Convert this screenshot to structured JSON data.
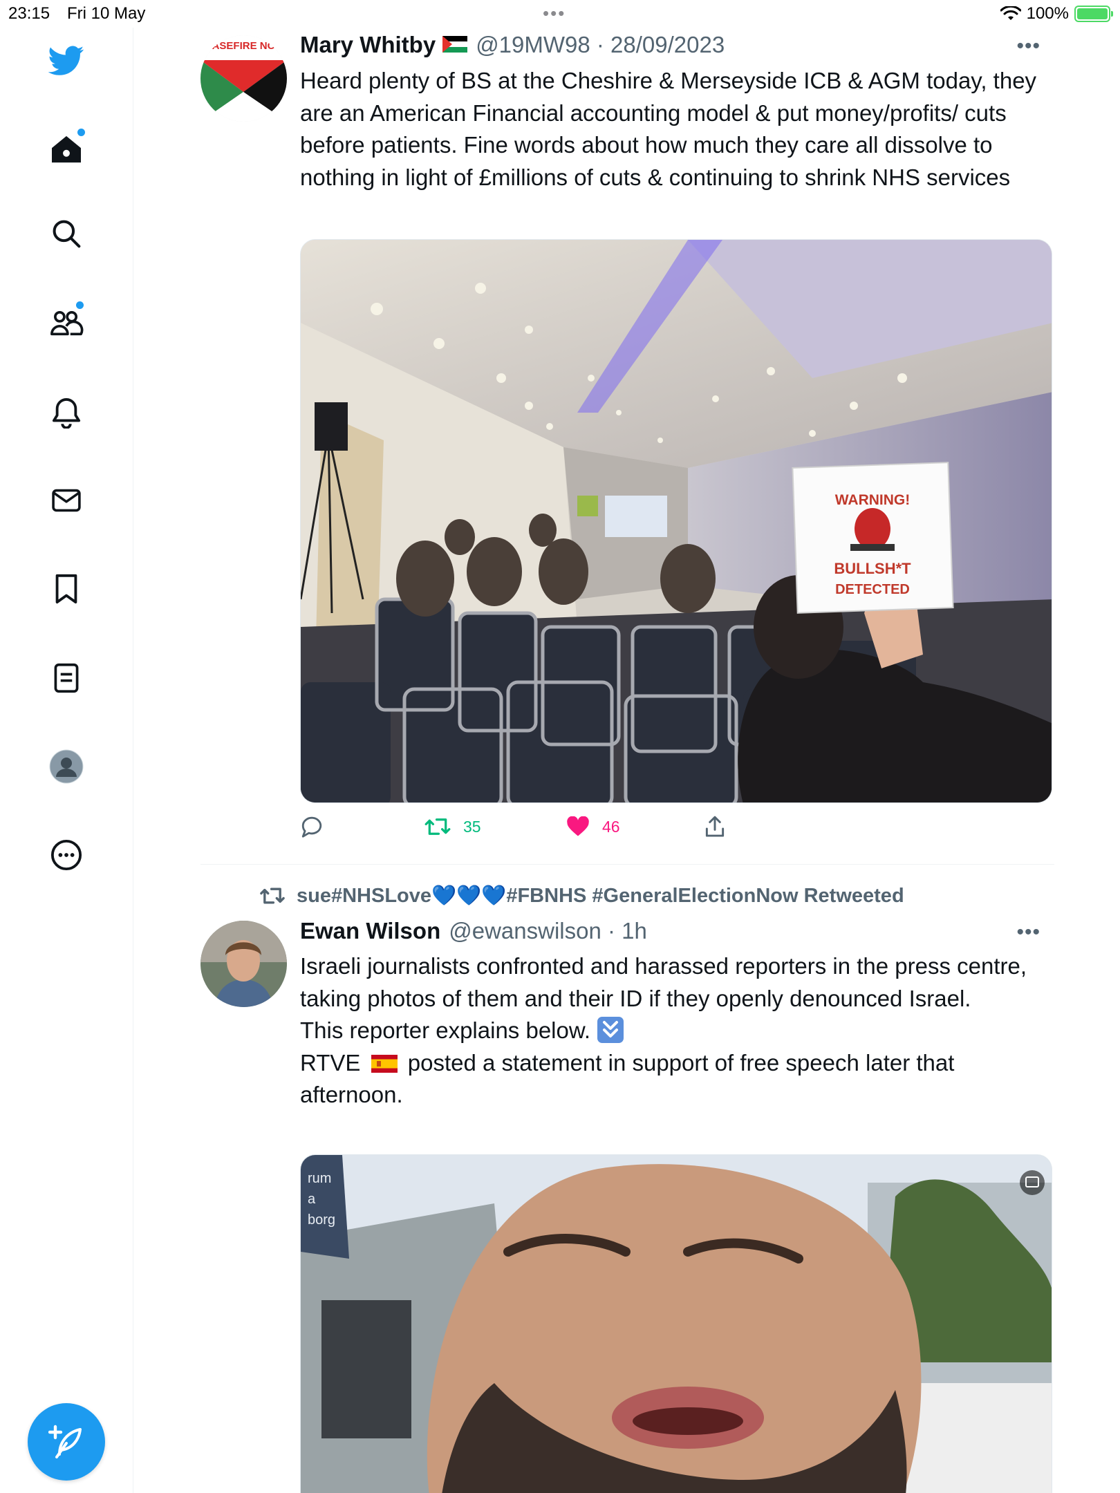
{
  "status_bar": {
    "time": "23:15",
    "date": "Fri 10 May",
    "battery": "100%",
    "battery_level": 1.0
  },
  "sidebar": {
    "items": [
      {
        "name": "home",
        "icon": "home-icon",
        "has_notification_dot": true
      },
      {
        "name": "explore",
        "icon": "search-icon"
      },
      {
        "name": "communities",
        "icon": "communities-icon",
        "has_notification_dot": true
      },
      {
        "name": "notifications",
        "icon": "bell-icon"
      },
      {
        "name": "messages",
        "icon": "mail-icon"
      },
      {
        "name": "bookmarks",
        "icon": "bookmark-icon"
      },
      {
        "name": "lists",
        "icon": "list-icon"
      },
      {
        "name": "profile",
        "icon": "profile-avatar-icon"
      },
      {
        "name": "more",
        "icon": "more-circle-icon"
      }
    ],
    "compose_icon": "compose-feather-icon"
  },
  "colors": {
    "brand_blue": "#1d9bf0",
    "text_primary": "#0f1419",
    "text_secondary": "#536471",
    "retweet_green": "#00ba7c",
    "like_pink": "#f91880"
  },
  "tweets": [
    {
      "author_name": "Mary Whitby",
      "author_flag": "palestine-flag",
      "meta": "@19MW98 · 28/09/2023",
      "text": "Heard plenty of BS at the Cheshire & Merseyside ICB & AGM today, they are an American Financial accounting model & put money/profits/ cuts before patients. Fine words about how much they care all dissolve to nothing in light of £millions of cuts & continuing to shrink NHS services",
      "avatar_text": "ASEFIRE NC",
      "media": {
        "type": "photo",
        "sign_line1": "WARNING!",
        "sign_line2": "BULLSH*T",
        "sign_line3": "DETECTED"
      },
      "actions": {
        "reply_count": "",
        "retweet_count": "35",
        "like_count": "46"
      }
    },
    {
      "retweeted_by": "sue#NHSLove💙💙💙#FBNHS #GeneralElectionNow Retweeted",
      "author_name": "Ewan Wilson",
      "meta": "@ewanswilson · 1h",
      "text_line1": "Israeli journalists confronted and harassed reporters in the press centre, taking photos of them and their ID if they openly denounced Israel.",
      "text_line2": "This reporter explains below.",
      "text_line3_before": "RTVE",
      "text_line3_after": "posted a statement in support of free speech later that afternoon.",
      "media": {
        "type": "video",
        "street_sign_text": "rum\na\nborg"
      }
    }
  ]
}
